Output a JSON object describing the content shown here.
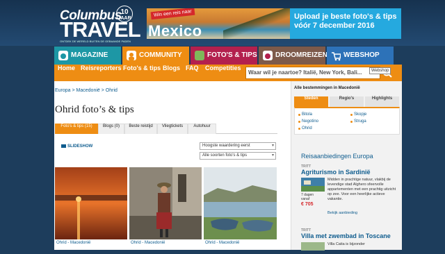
{
  "header": {
    "logo_line1": "Columbus",
    "logo_line2": "TRAVEL",
    "logo_tagline": "ONTDEK DE WERELD BUITEN DE GEBAANDE PADEN",
    "logo_badge_num": "10",
    "logo_badge_text": "JAAR",
    "banner_win": "Win een reis naar",
    "banner_destination": "Mexico",
    "banner_cta_line1": "Upload je beste foto's & tips",
    "banner_cta_line2": "vóór 7 december 2016"
  },
  "nav": {
    "tabs": [
      {
        "label": "MAGAZINE",
        "color": "#1d97a5"
      },
      {
        "label": "COMMUNITY",
        "color": "#ee8d13"
      },
      {
        "label": "FOTO'S & TIPS",
        "color": "#b3204e"
      },
      {
        "label": "DROOMREIZEN",
        "color": "#7d5a4a"
      },
      {
        "label": "WEBSHOP",
        "color": "#2d72b8"
      }
    ],
    "subnav": [
      "Home",
      "Reisreporters",
      "Foto's & tips",
      "Blogs",
      "FAQ",
      "Competities"
    ],
    "search_placeholder": "Waar wil je naartoe? Italië, New York, Bali...",
    "tooltip": "Webshop"
  },
  "main": {
    "breadcrumb": "Europa > Macedonië > Ohrid",
    "title": "Ohrid foto’s & tips",
    "tabs": [
      "Foto's & tips (15)",
      "Blogs (0)",
      "Beste reistijd",
      "Vliegtickets",
      "Autohuur"
    ],
    "slideshow": "SLIDESHOW",
    "sort_value": "Hoogste waardering eerst",
    "filter_value": "Alle soorten foto's & tips",
    "photos": [
      {
        "caption": "Ohrid - Macedonië"
      },
      {
        "caption": "Ohrid - Macedonië"
      },
      {
        "caption": "Ohrid - Macedonië"
      }
    ]
  },
  "sidebar": {
    "heading": "Alle bestemmingen in Macedonië",
    "tabs": [
      "Steden",
      "Regio's",
      "Highlights"
    ],
    "cities_col1": [
      "Bitola",
      "Negotino",
      "Ohrid"
    ],
    "cities_col2": [
      "Skopje",
      "Struga"
    ],
    "offers_heading": "Reisaanbiedingen Europa",
    "deals": [
      {
        "tag": "TRITT",
        "title": "Agriturismo in Sardinië",
        "duration": "7 dagen vanaf",
        "price": "€ 705",
        "desc": "Midden in prachtige natuur, vlakbij de levendige stad Alghero sfeervolle appartementen met een prachtig uitzicht op zee. Voor een heerlijke actieve vakantie.",
        "link": "Bekijk aanbieding"
      },
      {
        "tag": "TRITT",
        "title": "Villa met zwembad in Toscane",
        "desc": "Villa Catia is bijzonder"
      }
    ]
  }
}
